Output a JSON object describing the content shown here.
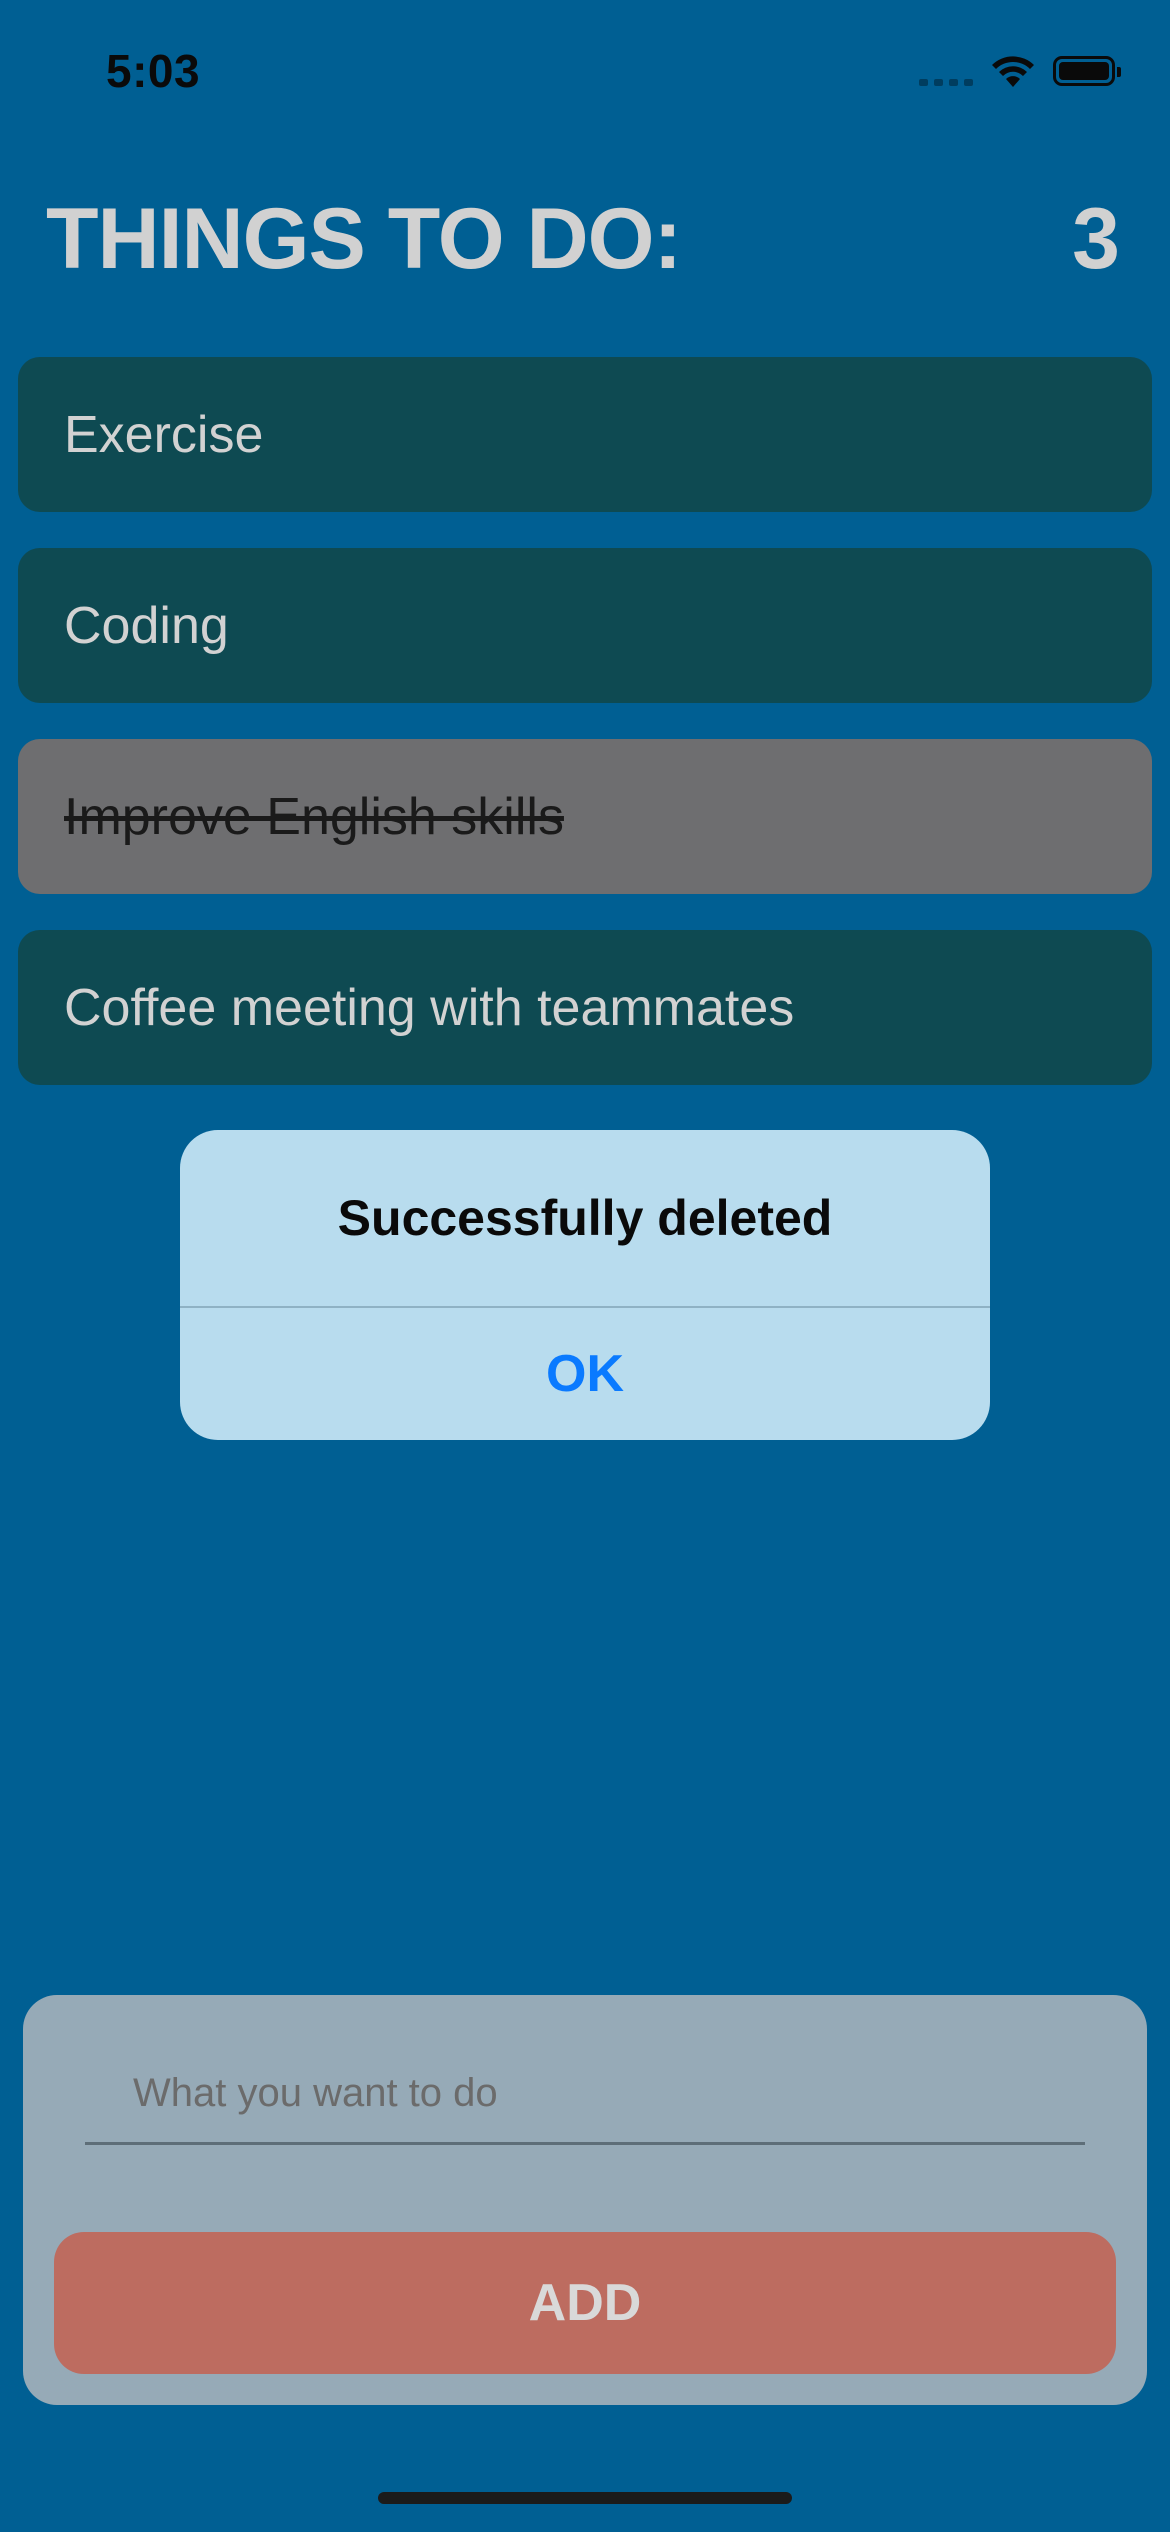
{
  "status_bar": {
    "time": "5:03",
    "icons": [
      "signal-icon",
      "wifi-icon",
      "battery-icon"
    ]
  },
  "header": {
    "title": "THINGS TO DO:",
    "count": "3"
  },
  "tasks": [
    {
      "label": "Exercise",
      "completed": false
    },
    {
      "label": "Coding",
      "completed": false
    },
    {
      "label": "Improve English skills",
      "completed": true
    },
    {
      "label": "Coffee meeting with teammates",
      "completed": false
    }
  ],
  "alert": {
    "title": "Successfully deleted",
    "ok_label": "OK"
  },
  "add_panel": {
    "input_value": "",
    "input_placeholder": "What you want to do",
    "add_label": "ADD"
  },
  "colors": {
    "background": "#005f93",
    "task_bg": "#0e4a52",
    "task_done_bg": "#6e6e70",
    "alert_bg": "#b8dcee",
    "accent_ok": "#0a7aff",
    "panel_bg": "#96aab7",
    "add_button": "#bd6c60"
  }
}
